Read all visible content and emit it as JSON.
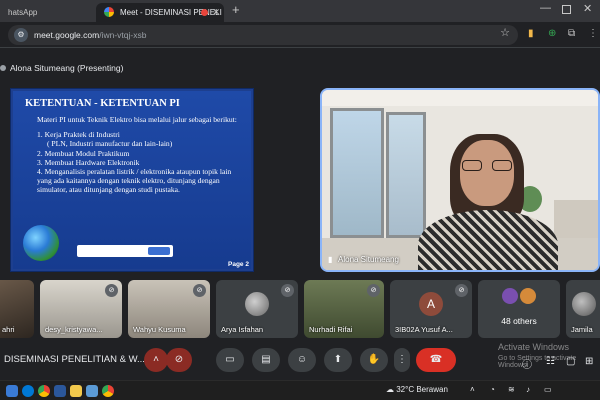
{
  "browser": {
    "tabs": [
      {
        "label": "hatsApp"
      },
      {
        "label": "Meet - DISEMINASI PENELI"
      }
    ],
    "url_host": "meet.google.com",
    "url_path": "/iwn-vtqj-xsb"
  },
  "meet": {
    "presenter_label": "Alona Situmeang (Presenting)",
    "slide": {
      "title": "KETENTUAN -  KETENTUAN PI",
      "intro": "Materi PI untuk Teknik Elektro bisa melalui jalur sebagai berikut:",
      "items": [
        "1. Kerja Praktek di Industri",
        "( PLN, Industri manufactur dan lain-lain)",
        "2.  Membuat Modul Praktikum",
        "3.  Membuat Hardware Elektronik",
        "4.  Menganalisis peralatan listrik / elektronika ataupun topik lain yang ada kaitannya dengan teknik elektro, ditunjang dengan simulator, atau ditunjang dengan studi pustaka."
      ],
      "page_label": "Page 2"
    },
    "speaker_name": "Alona Situmeang",
    "participants": [
      {
        "name": "ahri"
      },
      {
        "name": "desy_kristyawa..."
      },
      {
        "name": "Wahyu Kusuma"
      },
      {
        "name": "Arya Isfahan"
      },
      {
        "name": "Nurhadi Rifai"
      },
      {
        "name": "3IB02A Yusuf A...",
        "avatar_letter": "A"
      },
      {
        "name": "48 others"
      },
      {
        "name": "Jamila"
      }
    ],
    "meeting_title": "DISEMINASI PENELITIAN & W...",
    "watermark_line1": "Activate Windows",
    "watermark_line2": "Go to Settings to activate Windows."
  },
  "taskbar": {
    "temperature": "32°C",
    "weather": "Berawan"
  },
  "colors": {
    "accent": "#8ab4f8",
    "hangup": "#d93025",
    "slide_bg": "#1f4aa8"
  }
}
